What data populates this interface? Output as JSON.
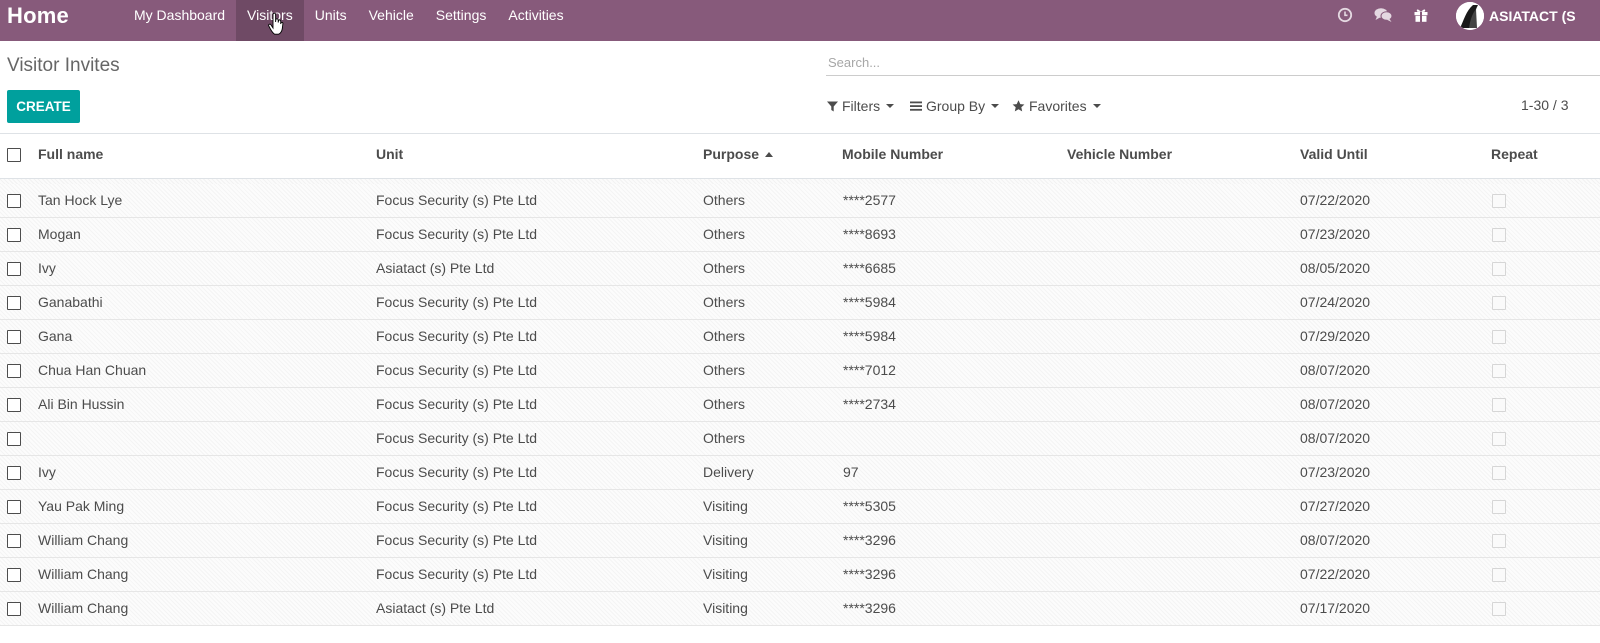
{
  "navbar": {
    "brand": "Home",
    "menu": [
      {
        "label": "My Dashboard"
      },
      {
        "label": "Visitors"
      },
      {
        "label": "Units"
      },
      {
        "label": "Vehicle"
      },
      {
        "label": "Settings"
      },
      {
        "label": "Activities"
      }
    ],
    "active_menu": "Visitors",
    "systray_icons": [
      "clock-icon",
      "chat-icon",
      "gift-icon"
    ],
    "company": "ASIATACT (S"
  },
  "control_panel": {
    "title": "Visitor Invites",
    "search_placeholder": "Search...",
    "create_label": "CREATE",
    "filters_label": "Filters",
    "groupby_label": "Group By",
    "favorites_label": "Favorites",
    "pager": "1-30 / 3"
  },
  "table": {
    "columns": [
      "Full name",
      "Unit",
      "Purpose",
      "Mobile Number",
      "Vehicle Number",
      "Valid Until",
      "Repeat"
    ],
    "sorted_column": "Purpose",
    "sort_direction": "ascending",
    "rows": [
      {
        "full_name": "Tan Hock Lye",
        "unit": "Focus Security (s) Pte Ltd",
        "purpose": "Others",
        "mobile": "****2577",
        "vehicle": "",
        "valid_until": "07/22/2020",
        "repeat": false
      },
      {
        "full_name": "Mogan",
        "unit": "Focus Security (s) Pte Ltd",
        "purpose": "Others",
        "mobile": "****8693",
        "vehicle": "",
        "valid_until": "07/23/2020",
        "repeat": false
      },
      {
        "full_name": "Ivy",
        "unit": "Asiatact (s) Pte Ltd",
        "purpose": "Others",
        "mobile": "****6685",
        "vehicle": "",
        "valid_until": "08/05/2020",
        "repeat": false
      },
      {
        "full_name": "Ganabathi",
        "unit": "Focus Security (s) Pte Ltd",
        "purpose": "Others",
        "mobile": "****5984",
        "vehicle": "",
        "valid_until": "07/24/2020",
        "repeat": false
      },
      {
        "full_name": "Gana",
        "unit": "Focus Security (s) Pte Ltd",
        "purpose": "Others",
        "mobile": "****5984",
        "vehicle": "",
        "valid_until": "07/29/2020",
        "repeat": false
      },
      {
        "full_name": "Chua Han Chuan",
        "unit": "Focus Security (s) Pte Ltd",
        "purpose": "Others",
        "mobile": "****7012",
        "vehicle": "",
        "valid_until": "08/07/2020",
        "repeat": false
      },
      {
        "full_name": "Ali Bin Hussin",
        "unit": "Focus Security (s) Pte Ltd",
        "purpose": "Others",
        "mobile": "****2734",
        "vehicle": "",
        "valid_until": "08/07/2020",
        "repeat": false
      },
      {
        "full_name": "",
        "unit": "Focus Security (s) Pte Ltd",
        "purpose": "Others",
        "mobile": "",
        "vehicle": "",
        "valid_until": "08/07/2020",
        "repeat": false
      },
      {
        "full_name": "Ivy",
        "unit": "Focus Security (s) Pte Ltd",
        "purpose": "Delivery",
        "mobile": "97",
        "vehicle": "",
        "valid_until": "07/23/2020",
        "repeat": false
      },
      {
        "full_name": "Yau Pak Ming",
        "unit": "Focus Security (s) Pte Ltd",
        "purpose": "Visiting",
        "mobile": "****5305",
        "vehicle": "",
        "valid_until": "07/27/2020",
        "repeat": false
      },
      {
        "full_name": "William Chang",
        "unit": "Focus Security (s) Pte Ltd",
        "purpose": "Visiting",
        "mobile": "****3296",
        "vehicle": "",
        "valid_until": "08/07/2020",
        "repeat": false
      },
      {
        "full_name": "William Chang",
        "unit": "Focus Security (s) Pte Ltd",
        "purpose": "Visiting",
        "mobile": "****3296",
        "vehicle": "",
        "valid_until": "07/22/2020",
        "repeat": false
      },
      {
        "full_name": "William Chang",
        "unit": "Asiatact (s) Pte Ltd",
        "purpose": "Visiting",
        "mobile": "****3296",
        "vehicle": "",
        "valid_until": "07/17/2020",
        "repeat": false
      }
    ]
  },
  "colors": {
    "navbar": "#875a7b",
    "navbar_active": "#6f4a65",
    "primary_button": "#00a09d"
  }
}
